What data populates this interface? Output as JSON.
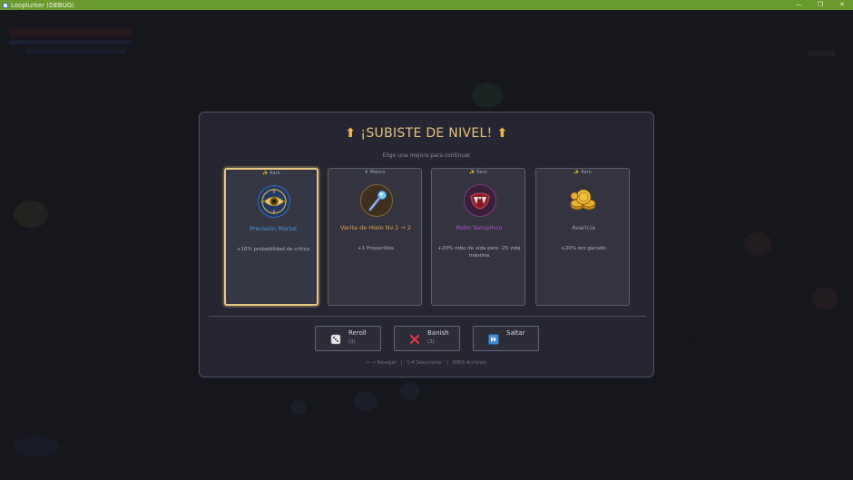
{
  "window": {
    "title": "Looplurker (DEBUG)",
    "minimize": "—",
    "maximize": "❐",
    "close": "✕"
  },
  "modal": {
    "title": "¡SUBISTE DE NIVEL!",
    "arrow": "⬆",
    "subtitle": "Elige una mejora para continuar"
  },
  "cards": [
    {
      "rarity": "✨ Raro",
      "icon": "eye-icon",
      "name": "Precisión Mortal",
      "name_color": "#4a9be8",
      "desc": "+10% probabilidad de crítico"
    },
    {
      "rarity": "⬆ Mejora",
      "icon": "ice-wand-icon",
      "name": "Varita de Hielo Nv.1 → 2",
      "name_color": "#e0a04a",
      "desc": "+1 Proyectiles"
    },
    {
      "rarity": "✨ Raro",
      "icon": "fangs-icon",
      "name": "Robo Vampírico",
      "name_color": "#b355d6",
      "desc": "+20% robo de vida pero -25 vida máxima"
    },
    {
      "rarity": "✨ Raro",
      "icon": "gold-coins-icon",
      "name": "Avaricia",
      "name_color": "#a6a8b5",
      "desc": "+20% oro ganado"
    }
  ],
  "actions": [
    {
      "label": "Reroll",
      "count": "(3)",
      "icon": "dice-icon"
    },
    {
      "label": "Banish",
      "count": "(3)",
      "icon": "x-icon"
    },
    {
      "label": "Saltar",
      "count": "",
      "icon": "skip-icon"
    }
  ],
  "footer": {
    "navigate": "← → Navegar",
    "confirm": "1-4 Seleccionar",
    "shortcuts": "R/B/S Acciones"
  }
}
